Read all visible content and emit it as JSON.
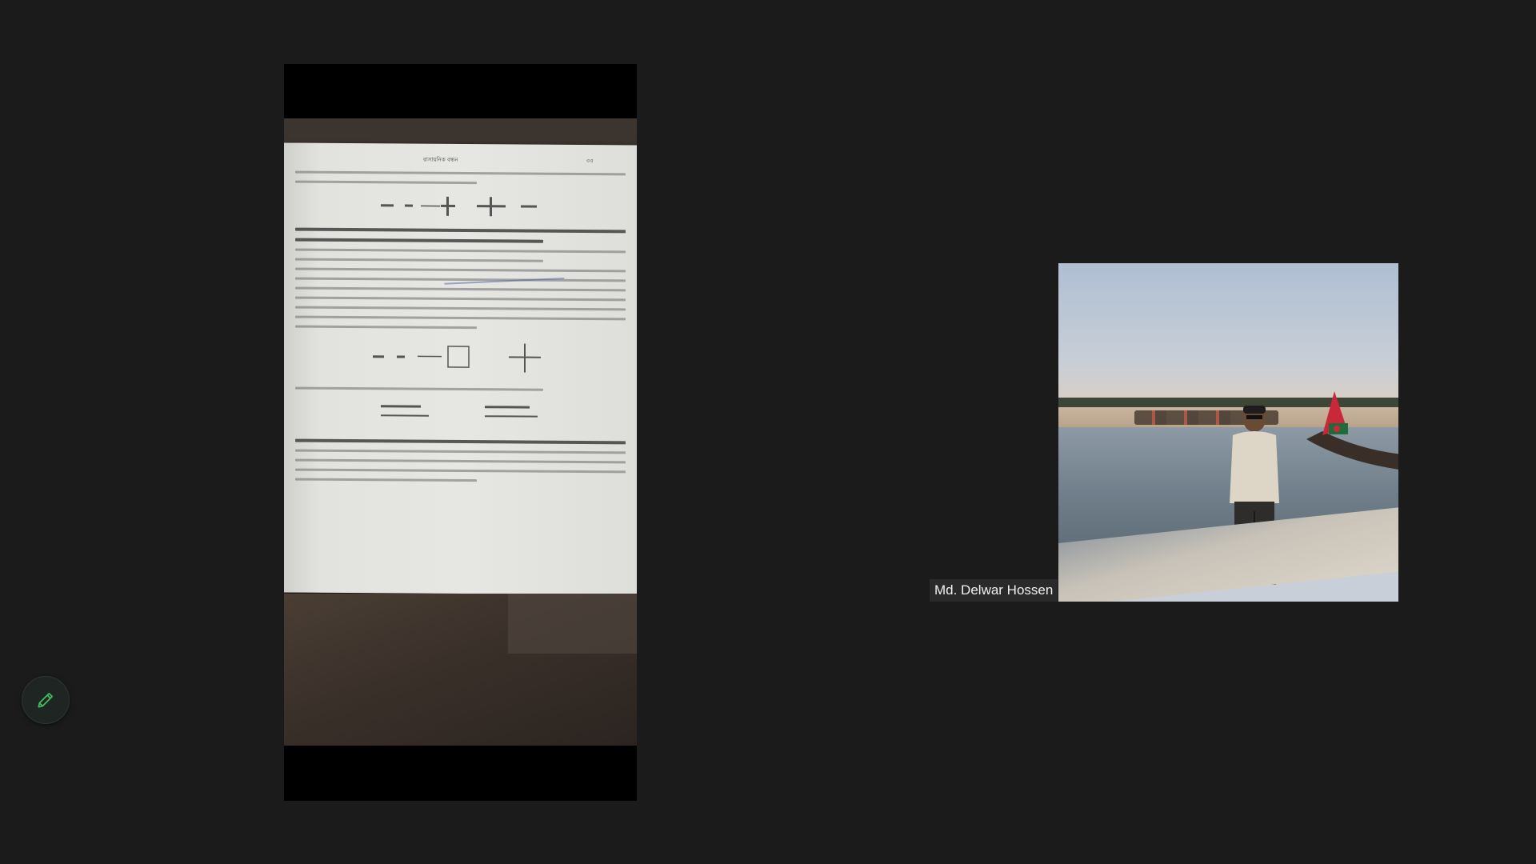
{
  "meeting": {
    "participant_name": "Md. Delwar Hossen"
  },
  "controls": {
    "pen_icon": "pencil-icon",
    "pen_color": "#3fbf5f"
  },
  "shared_content": {
    "page_header_title": "রাসায়নিক বন্ধন",
    "page_number": "৩৫"
  }
}
